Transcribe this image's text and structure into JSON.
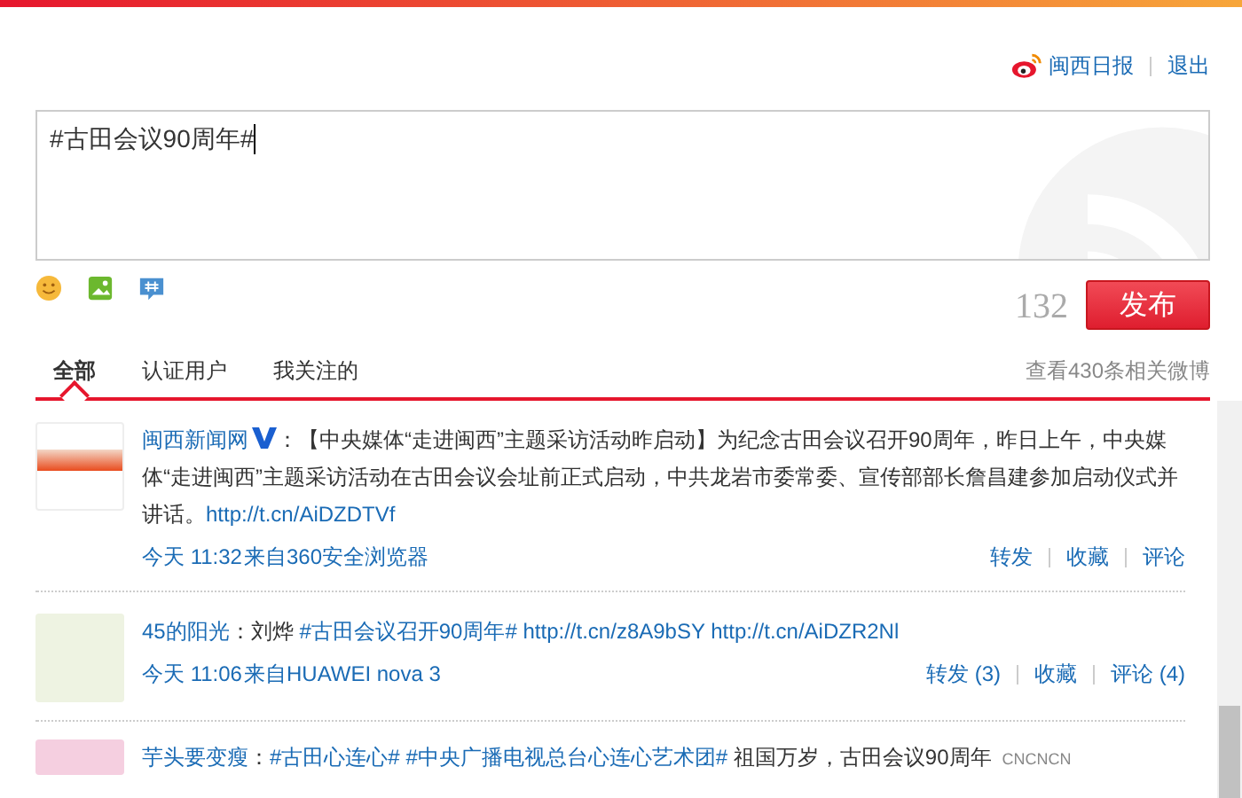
{
  "header": {
    "account": "闽西日报",
    "logout": "退出"
  },
  "composer": {
    "value": "#古田会议90周年#",
    "counter": "132",
    "submit": "发布"
  },
  "tabs": [
    {
      "label": "全部",
      "selected": true
    },
    {
      "label": "认证用户",
      "selected": false
    },
    {
      "label": "我关注的",
      "selected": false
    }
  ],
  "more_link": "查看430条相关微博",
  "posts": [
    {
      "author": "闽西新闻网",
      "colon": "：",
      "verified": true,
      "segments": [
        {
          "kind": "text",
          "text": "【中央媒体“走进闽西”主题采访活动昨启动】为纪念古田会议召开90周年，昨日上午，中央媒体“走进闽西”主题采访活动在古田会议会址前正式启动，中共龙岩市委常委、宣传部部长詹昌建参加启动仪式并讲话。"
        },
        {
          "kind": "link",
          "text": "http://t.cn/AiDZDTVf"
        }
      ],
      "time": "今天 11:32",
      "source": "来自360安全浏览器",
      "actions": [
        "转发",
        "收藏",
        "评论"
      ]
    },
    {
      "author": "45的阳光",
      "colon": "：",
      "verified": false,
      "segments": [
        {
          "kind": "text",
          "text": "刘烨 "
        },
        {
          "kind": "link",
          "text": "#古田会议召开90周年#"
        },
        {
          "kind": "link",
          "text": "http://t.cn/z8A9bSY"
        },
        {
          "kind": "link",
          "text": "http://t.cn/AiDZR2Nl"
        }
      ],
      "time": "今天 11:06",
      "source": "来自HUAWEI nova 3",
      "actions": [
        "转发 (3)",
        "收藏",
        "评论 (4)"
      ]
    },
    {
      "author": "芋头要变瘦",
      "colon": "：",
      "verified": false,
      "segments": [
        {
          "kind": "link",
          "text": "#古田心连心#"
        },
        {
          "kind": "link",
          "text": "#中央广播电视总台心连心艺术团#"
        },
        {
          "kind": "text",
          "text": " 祖国万岁，古田会议90周年"
        },
        {
          "kind": "note",
          "text": "CNCNCN"
        }
      ]
    }
  ]
}
